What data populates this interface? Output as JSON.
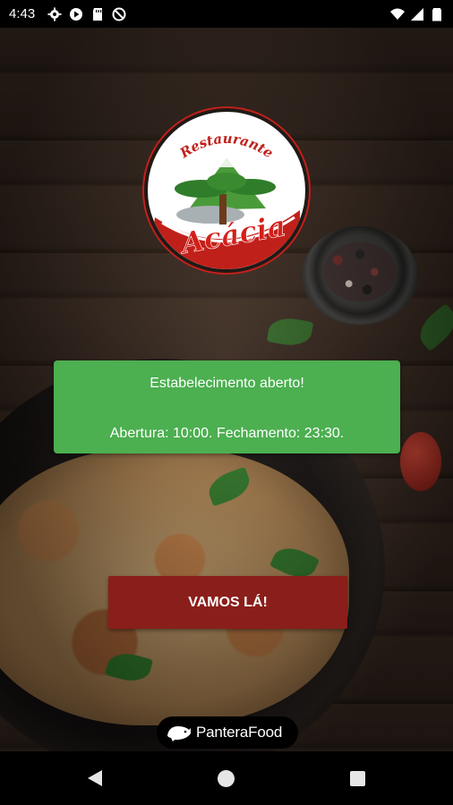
{
  "status_bar": {
    "time": "4:43",
    "left_icons": [
      "gear-icon",
      "play-icon",
      "sd-card-icon",
      "no-disturb-icon"
    ],
    "right_icons": [
      "wifi-icon",
      "signal-icon",
      "battery-icon"
    ]
  },
  "logo": {
    "top_text": "Restaurante",
    "name": "Acácia"
  },
  "status_card": {
    "title": "Estabelecimento aberto!",
    "hours": "Abertura: 10:00. Fechamento: 23:30."
  },
  "actions": {
    "go_label": "VAMOS LÁ!"
  },
  "brand": {
    "name": "PanteraFood"
  },
  "colors": {
    "card_green": "#4caf50",
    "button_red": "#8a1e1a"
  }
}
